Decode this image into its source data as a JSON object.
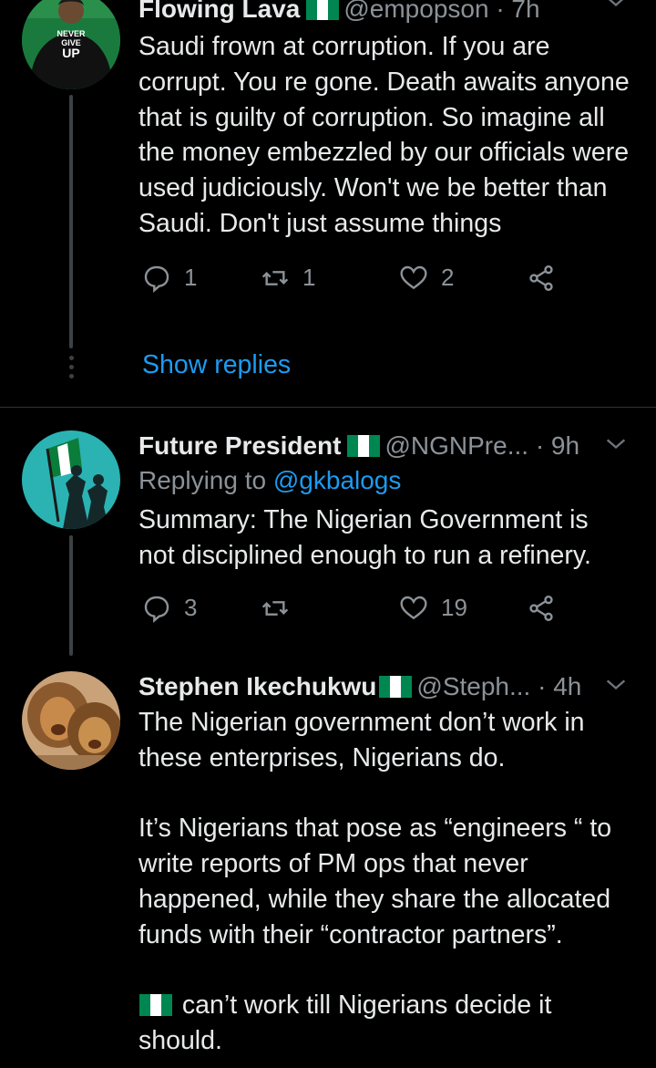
{
  "tweet1": {
    "name": "Flowing Lava",
    "handle": "@empopson",
    "time": "· 7h",
    "text": "Saudi frown at corruption. If you are corrupt. You re gone. Death awaits anyone that is guilty of corruption. So imagine all the money embezzled by our officials were used judiciously. Won't we be better than Saudi. Don't just assume things",
    "avatar_text": [
      "NEVER",
      "GIVE",
      "UP"
    ],
    "replies": "1",
    "retweets": "1",
    "likes": "2"
  },
  "show_replies_label": "Show replies",
  "tweet2": {
    "name": "Future President",
    "handle": "@NGNPre...",
    "time": "· 9h",
    "replying_prefix": "Replying to ",
    "replying_to": "@gkbalogs",
    "text": "Summary: The Nigerian Government is not disciplined enough to run a refinery.",
    "replies": "3",
    "retweets": "",
    "likes": "19"
  },
  "tweet3": {
    "name": "Stephen Ikechukwu",
    "handle": "@Steph...",
    "time": "· 4h",
    "text": "The Nigerian government don’t work in these enterprises, Nigerians do.\n\nIt’s Nigerians that pose as “engineers “ to write reports of PM ops that never happened, while they share the allocated funds with their “contractor partners”.\n\n",
    "text_end": " can’t work till Nigerians decide it should."
  },
  "colors": {
    "background": "#000000",
    "text": "#e7e9ea",
    "muted": "#8b9298",
    "link": "#1d9bf0",
    "flag_green": "#008751"
  }
}
